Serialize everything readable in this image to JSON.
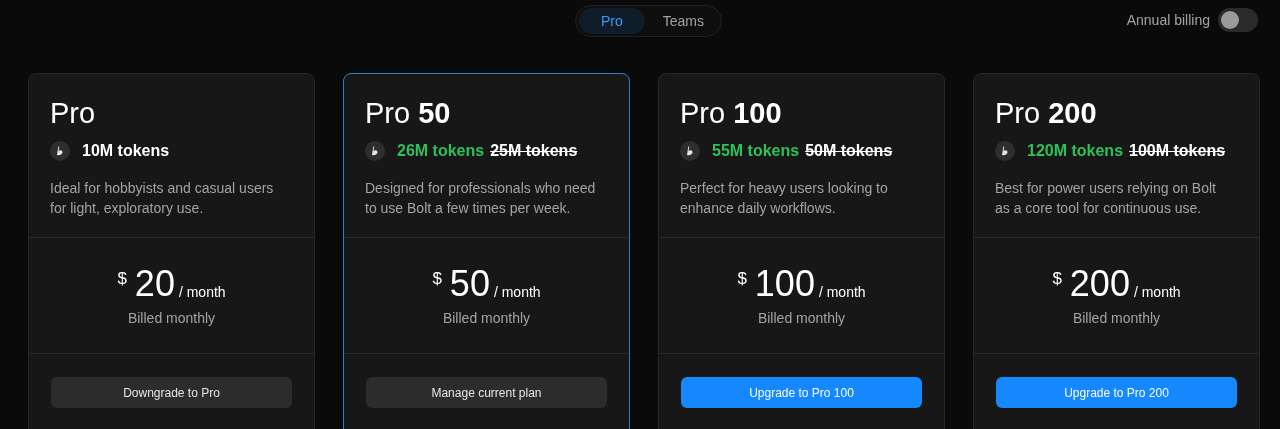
{
  "tabs": [
    {
      "label": "Pro",
      "selected": true
    },
    {
      "label": "Teams",
      "selected": false
    }
  ],
  "billing_toggle": {
    "label": "Annual billing",
    "on": false
  },
  "plans": [
    {
      "title": "Pro",
      "current": false,
      "tokens": "10M tokens",
      "tokens_highlighted": false,
      "description": "Ideal for hobbyists and casual users for light, exploratory use.",
      "currency": "$",
      "price": "20",
      "period": "/ month",
      "billing": "Billed monthly",
      "button": {
        "label": "Downgrade to Pro",
        "kind": "secondary"
      }
    },
    {
      "title": "Pro **50**",
      "current": true,
      "tokens": "26M tokens",
      "tokens_highlighted": true,
      "old_tokens": "25M tokens",
      "description": "Designed for professionals who need to use Bolt a few times per week.",
      "currency": "$",
      "price": "50",
      "period": "/ month",
      "billing": "Billed monthly",
      "button": {
        "label": "Manage current plan",
        "kind": "secondary"
      }
    },
    {
      "title": "Pro **100**",
      "current": false,
      "tokens": "55M tokens",
      "tokens_highlighted": true,
      "old_tokens": "50M tokens",
      "description": "Perfect for heavy users looking to enhance daily workflows.",
      "currency": "$",
      "price": "100",
      "period": "/ month",
      "billing": "Billed monthly",
      "button": {
        "label": "Upgrade to Pro 100",
        "kind": "primary"
      }
    },
    {
      "title": "Pro **200**",
      "current": false,
      "tokens": "120M tokens",
      "tokens_highlighted": true,
      "old_tokens": "100M tokens",
      "description": "Best for power users relying on Bolt as a core tool for continuous use.",
      "currency": "$",
      "price": "200",
      "period": "/ month",
      "billing": "Billed monthly",
      "button": {
        "label": "Upgrade to Pro 200",
        "kind": "primary"
      }
    }
  ]
}
